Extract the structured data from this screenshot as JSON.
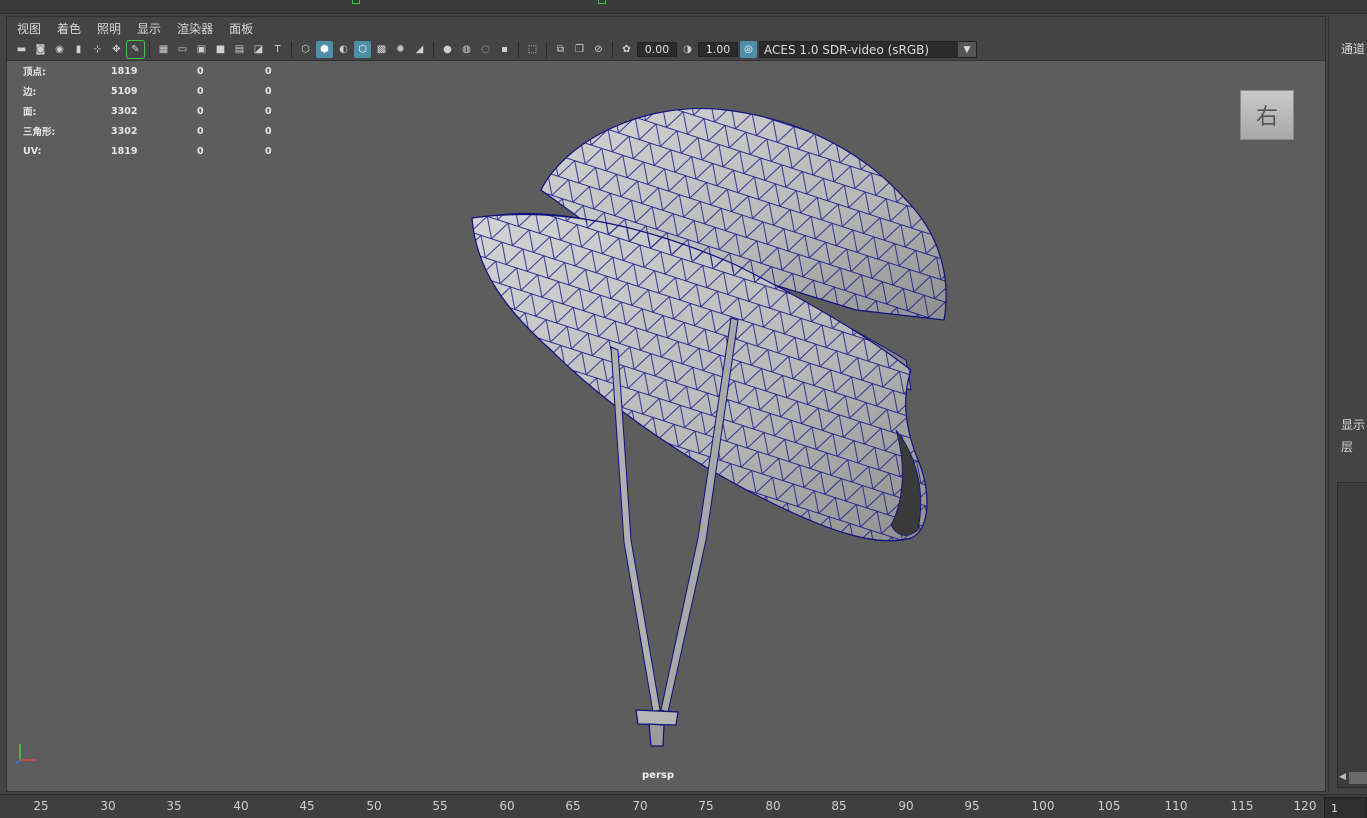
{
  "menubar": {
    "items": [
      "视图",
      "着色",
      "照明",
      "显示",
      "渲染器",
      "面板"
    ]
  },
  "toolbar": {
    "exposure_value": "0.00",
    "gamma_value": "1.00",
    "color_space": "ACES 1.0 SDR-video (sRGB)",
    "icons": [
      "camera-icon",
      "camera-attrs-icon",
      "bookmark-icon",
      "image-plane-icon",
      "2d-pan-icon",
      "grease-pencil-icon",
      "grid-icon",
      "film-gate-icon",
      "resolution-gate-icon",
      "gate-mask-icon",
      "field-chart-icon",
      "safe-action-icon",
      "safe-title-icon",
      "wireframe-icon",
      "smooth-shade-icon",
      "default-material-icon",
      "wireframe-on-shaded-icon",
      "xray-icon",
      "use-lights-icon",
      "shadows-icon",
      "screen-space-ao-icon",
      "motion-blur-icon",
      "multisample-aa-icon",
      "depth-of-field-icon",
      "isolate-select-icon",
      "xray-joints-icon",
      "xray-active-icon",
      "backface-culling-icon",
      "exposure-icon",
      "gamma-icon",
      "color-management-icon"
    ]
  },
  "hud": {
    "rows": [
      {
        "label": "顶点:",
        "v1": "1819",
        "v2": "0",
        "v3": "0"
      },
      {
        "label": "边:",
        "v1": "5109",
        "v2": "0",
        "v3": "0"
      },
      {
        "label": "面:",
        "v1": "3302",
        "v2": "0",
        "v3": "0"
      },
      {
        "label": "三角形:",
        "v1": "3302",
        "v2": "0",
        "v3": "0"
      },
      {
        "label": "UV:",
        "v1": "1819",
        "v2": "0",
        "v3": "0"
      }
    ]
  },
  "viewcube": {
    "face_label": "右"
  },
  "viewport": {
    "camera_label": "persp"
  },
  "right_panel": {
    "channel_label": "通道",
    "display_label": "显示",
    "layer_label": "层"
  },
  "timeline": {
    "ticks": [
      "25",
      "30",
      "35",
      "40",
      "45",
      "50",
      "55",
      "60",
      "65",
      "70",
      "75",
      "80",
      "85",
      "90",
      "95",
      "100",
      "105",
      "110",
      "115",
      "120"
    ],
    "current_frame": "1"
  }
}
